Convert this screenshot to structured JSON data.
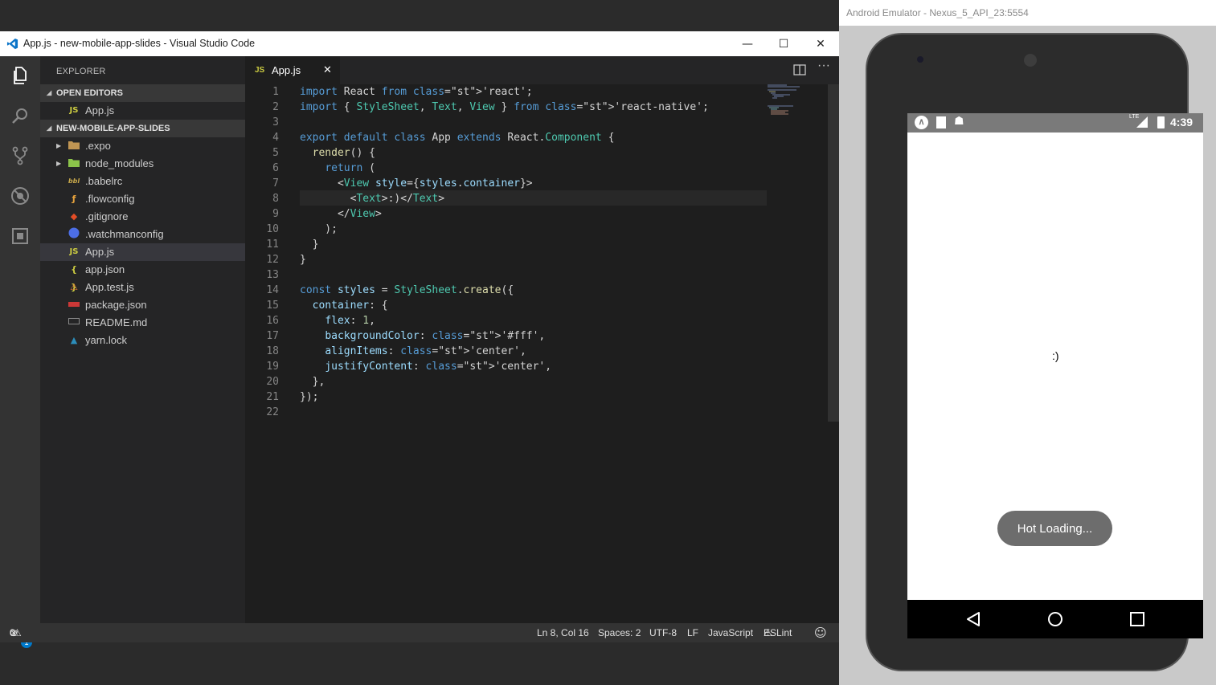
{
  "vscode": {
    "window_title": "App.js - new-mobile-app-slides - Visual Studio Code",
    "controls": {
      "minimize": "—",
      "maximize": "☐",
      "close": "✕"
    },
    "activity_icons": [
      "files-icon",
      "search-icon",
      "source-control-icon",
      "debug-icon",
      "extensions-icon",
      "settings-gear-icon"
    ],
    "settings_badge": "1",
    "sidebar": {
      "title": "EXPLORER",
      "open_editors": "OPEN EDITORS",
      "open_editor_file": "App.js",
      "project": "NEW-MOBILE-APP-SLIDES",
      "folders": [
        ".expo",
        "node_modules"
      ],
      "files": [
        ".babelrc",
        ".flowconfig",
        ".gitignore",
        ".watchmanconfig",
        "App.js",
        "app.json",
        "App.test.js",
        "package.json",
        "README.md",
        "yarn.lock"
      ]
    },
    "tab": {
      "label": "App.js",
      "lang_badge": "JS",
      "close": "✕"
    },
    "line_numbers": [
      "1",
      "2",
      "3",
      "4",
      "5",
      "6",
      "7",
      "8",
      "9",
      "10",
      "11",
      "12",
      "13",
      "14",
      "15",
      "16",
      "17",
      "18",
      "19",
      "20",
      "21",
      "22"
    ],
    "code": [
      "import React from 'react';",
      "import { StyleSheet, Text, View } from 'react-native';",
      "",
      "export default class App extends React.Component {",
      "  render() {",
      "    return (",
      "      <View style={styles.container}>",
      "        <Text>:)</Text>",
      "      </View>",
      "    );",
      "  }",
      "}",
      "",
      "const styles = StyleSheet.create({",
      "  container: {",
      "    flex: 1,",
      "    backgroundColor: '#fff',",
      "    alignItems: 'center',",
      "    justifyContent: 'center',",
      "  },",
      "});",
      ""
    ],
    "status": {
      "errors": "0",
      "warnings": "0",
      "position": "Ln 8, Col 16",
      "spaces": "Spaces: 2",
      "encoding": "UTF-8",
      "eol": "LF",
      "language": "JavaScript",
      "linter": "ESLint"
    }
  },
  "emulator": {
    "window_title": "Android Emulator - Nexus_5_API_23:5554",
    "clock": "4:39",
    "lte": "LTE",
    "app_text": ":)",
    "toast": "Hot Loading..."
  },
  "colors": {
    "editor_bg": "#1e1e1e",
    "sidebar_bg": "#252526",
    "activity_bg": "#333333",
    "status_bg": "#333333",
    "keyword": "#569cd6",
    "string": "#ce9178"
  }
}
